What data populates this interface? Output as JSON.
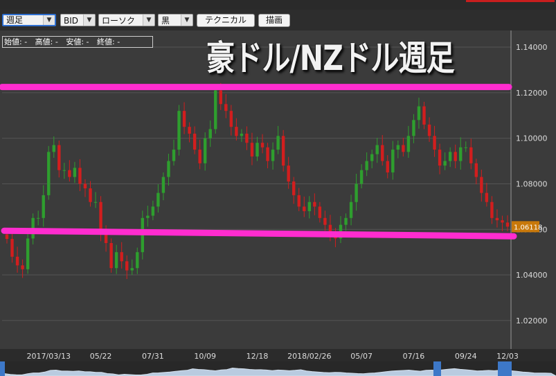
{
  "toolbar": {
    "period_select": "週足",
    "price_select": "BID",
    "chart_type_select": "ローソク",
    "color_select": "黒",
    "technical_button": "テクニカル",
    "draw_button": "描画"
  },
  "ohlc": {
    "open_label": "始値: -",
    "high_label": "高値: -",
    "low_label": "安値: -",
    "close_label": "終値: -"
  },
  "overlay_title": "豪ドル/NZドル週足",
  "colors": {
    "up": "#2e9e2e",
    "down": "#d21e1e",
    "hline": "#ff2ccf",
    "background": "#3b3b3b",
    "last_price_tag": "#c8780a"
  },
  "chart_data": {
    "type": "candlestick",
    "title": "",
    "xlabel": "",
    "ylabel": "",
    "x_ticks": [
      "2017/03/13",
      "05/22",
      "07/31",
      "10/09",
      "12/18",
      "2018/02/26",
      "05/07",
      "07/16",
      "09/24",
      "12/03"
    ],
    "y_ticks": [
      "1.02000",
      "1.04000",
      "1.06000",
      "1.08000",
      "1.10000",
      "1.12000",
      "1.14000"
    ],
    "y_tick_values": [
      1.02,
      1.04,
      1.06,
      1.08,
      1.1,
      1.12,
      1.14
    ],
    "ylim": [
      1.0075,
      1.1473
    ],
    "last_price": "1.06118",
    "last_price_value": 1.06118,
    "horizontal_lines": [
      1.1225,
      1.0585
    ],
    "series_weekly_close": [
      1.0558,
      1.048,
      1.0442,
      1.0425,
      1.056,
      1.065,
      1.065,
      1.075,
      1.094,
      1.097,
      1.086,
      1.086,
      1.083,
      1.087,
      1.08,
      1.078,
      1.072,
      1.072,
      1.058,
      1.054,
      1.043,
      1.05,
      1.046,
      1.042,
      1.043,
      1.05,
      1.065,
      1.066,
      1.07,
      1.076,
      1.083,
      1.09,
      1.095,
      1.112,
      1.105,
      1.102,
      1.095,
      1.089,
      1.1,
      1.104,
      1.121,
      1.115,
      1.112,
      1.105,
      1.101,
      1.102,
      1.098,
      1.092,
      1.098,
      1.096,
      1.09,
      1.095,
      1.101,
      1.088,
      1.081,
      1.075,
      1.07,
      1.068,
      1.072,
      1.07,
      1.065,
      1.062,
      1.058,
      1.056,
      1.062,
      1.065,
      1.072,
      1.08,
      1.086,
      1.09,
      1.093,
      1.097,
      1.09,
      1.085,
      1.095,
      1.097,
      1.094,
      1.101,
      1.108,
      1.114,
      1.106,
      1.101,
      1.095,
      1.088,
      1.09,
      1.094,
      1.09,
      1.096,
      1.096,
      1.089,
      1.083,
      1.076,
      1.072,
      1.065,
      1.064,
      1.063,
      1.0612
    ]
  }
}
